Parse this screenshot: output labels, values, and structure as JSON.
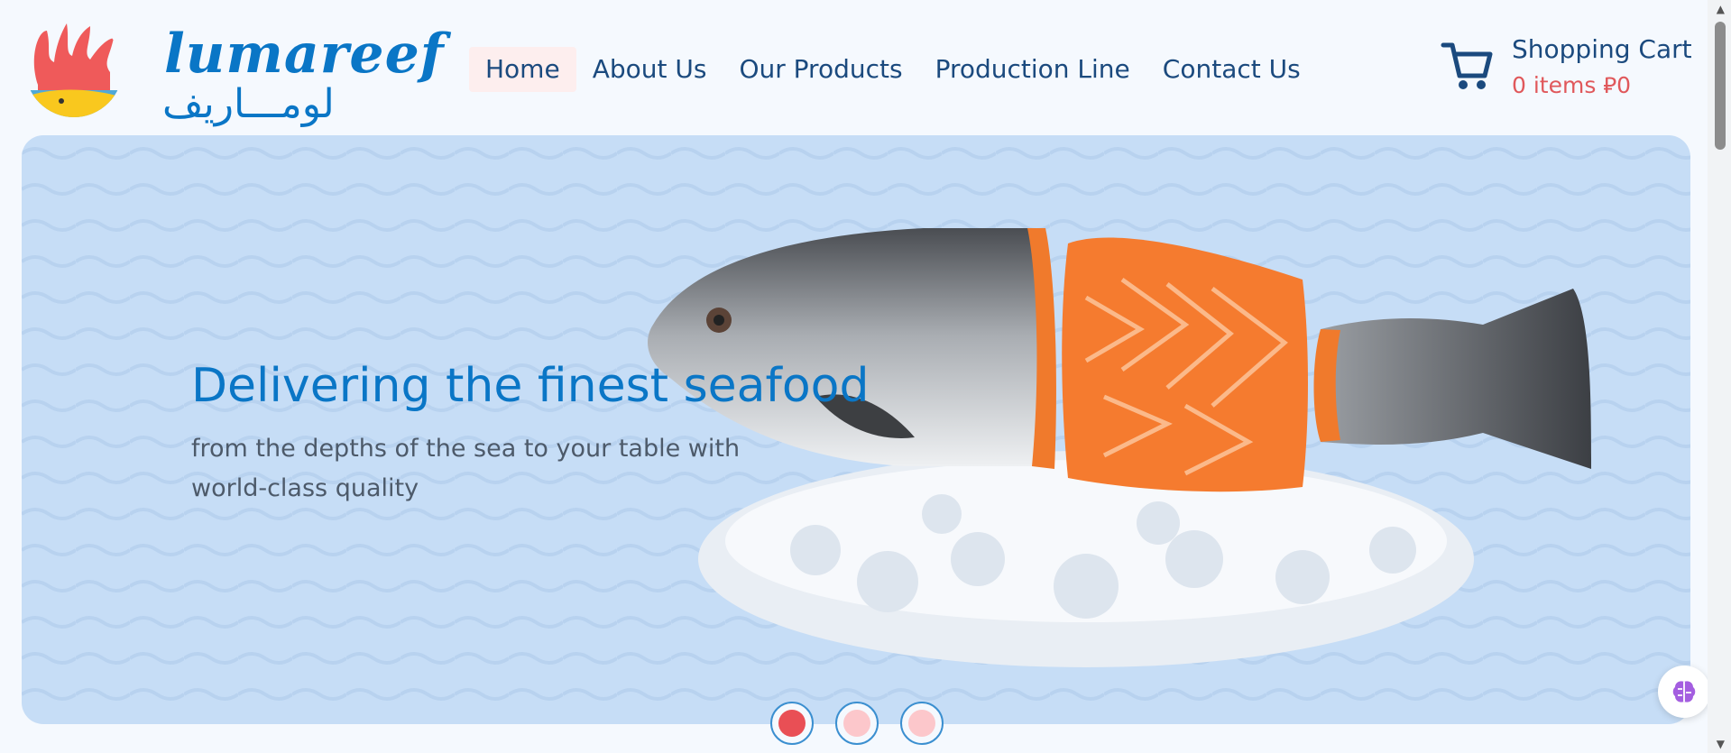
{
  "brand": {
    "name_latin": "lumareef",
    "name_arabic": "لومـــاريف"
  },
  "nav": {
    "items": [
      {
        "label": "Home",
        "active": true
      },
      {
        "label": "About Us",
        "active": false
      },
      {
        "label": "Our Products",
        "active": false
      },
      {
        "label": "Production Line",
        "active": false
      },
      {
        "label": "Contact Us",
        "active": false
      }
    ]
  },
  "cart": {
    "label": "Shopping Cart",
    "count_text": "0 items ⃁0",
    "icon": "cart-icon"
  },
  "hero": {
    "title": "Delivering the finest seafood",
    "subtitle": "from the depths of the sea to your table with world-class quality",
    "slides": [
      {
        "active": true
      },
      {
        "active": false
      },
      {
        "active": false
      }
    ]
  },
  "colors": {
    "brand_blue": "#0a76c6",
    "nav_text": "#1b4a7e",
    "accent_red": "#e0585b",
    "hero_bg": "#c6ddf6",
    "dot_active": "#e94f55",
    "dot_inactive": "#fcc7cb"
  }
}
